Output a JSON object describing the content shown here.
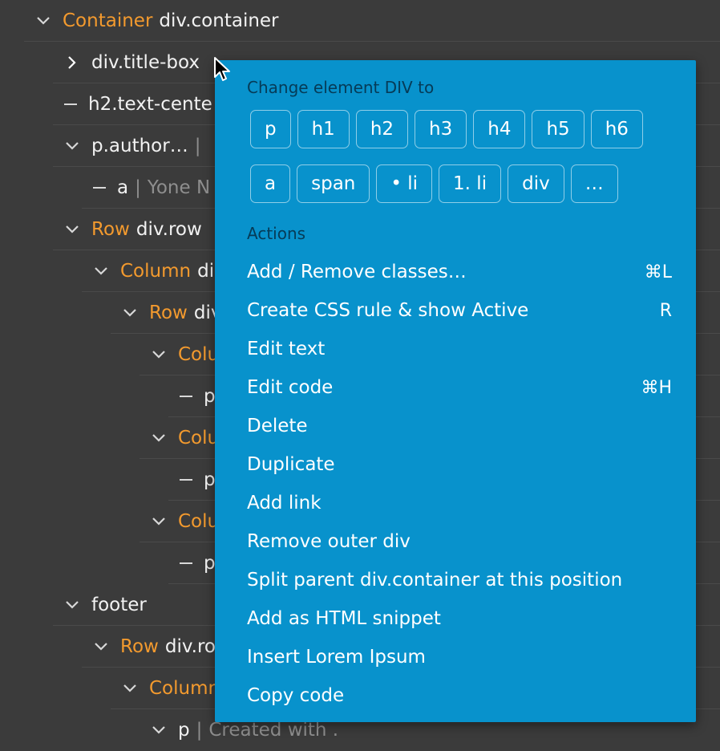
{
  "tree": [
    {
      "kw": "Container",
      "label": "div.container",
      "text": "",
      "twisty": "down"
    },
    {
      "kw": "",
      "label": "div.title-box",
      "text": "",
      "twisty": "right"
    },
    {
      "kw": "",
      "label": "h2.text-cente",
      "text": "",
      "twisty": "dash"
    },
    {
      "kw": "",
      "label": "p.author…",
      "text": "",
      "twisty": "down"
    },
    {
      "kw": "",
      "label": "a",
      "text": "Yone N",
      "twisty": "dash"
    },
    {
      "kw": "Row",
      "label": "div.row",
      "text": "",
      "twisty": "down"
    },
    {
      "kw": "Column",
      "label": "di",
      "text": "",
      "twisty": "down"
    },
    {
      "kw": "Row",
      "label": "div",
      "text": "",
      "twisty": "down"
    },
    {
      "kw": "Colu",
      "label": "",
      "text": "",
      "twisty": "down"
    },
    {
      "kw": "",
      "label": "p",
      "text": "",
      "twisty": "dash"
    },
    {
      "kw": "Colu",
      "label": "",
      "text": "",
      "twisty": "down"
    },
    {
      "kw": "",
      "label": "p",
      "text": "",
      "twisty": "dash"
    },
    {
      "kw": "Colu",
      "label": "",
      "text": "",
      "twisty": "down"
    },
    {
      "kw": "",
      "label": "p",
      "text": "",
      "twisty": "dash"
    },
    {
      "kw": "",
      "label": "footer",
      "text": "",
      "twisty": "down"
    },
    {
      "kw": "Row",
      "label": "div.ro",
      "text": "",
      "twisty": "down"
    },
    {
      "kw": "Column",
      "label": "",
      "text": "",
      "twisty": "down"
    },
    {
      "kw": "",
      "label": "p",
      "text": "Created with .",
      "twisty": "down"
    }
  ],
  "menu": {
    "header": "Change element DIV to",
    "tags_row1": [
      "p",
      "h1",
      "h2",
      "h3",
      "h4",
      "h5",
      "h6"
    ],
    "tags_row2": [
      "a",
      "span",
      "• li",
      "1. li",
      "div",
      "…"
    ],
    "actions_label": "Actions",
    "actions": [
      {
        "label": "Add / Remove classes…",
        "shortcut": "⌘L"
      },
      {
        "label": "Create CSS rule & show Active",
        "shortcut": "R"
      },
      {
        "label": "Edit text",
        "shortcut": ""
      },
      {
        "label": "Edit code",
        "shortcut": "⌘H"
      },
      {
        "label": "Delete",
        "shortcut": ""
      },
      {
        "label": "Duplicate",
        "shortcut": ""
      },
      {
        "label": "Add link",
        "shortcut": ""
      },
      {
        "label": "Remove outer div",
        "shortcut": ""
      },
      {
        "label": "Split parent div.container at this position",
        "shortcut": ""
      },
      {
        "label": "Add as HTML snippet",
        "shortcut": ""
      },
      {
        "label": "Insert Lorem Ipsum",
        "shortcut": ""
      },
      {
        "label": "Copy code",
        "shortcut": ""
      }
    ]
  },
  "colors": {
    "background": "#3b3b3b",
    "keyword": "#f39a2e",
    "menu_bg": "#0892cc",
    "menu_label": "#063b57"
  }
}
